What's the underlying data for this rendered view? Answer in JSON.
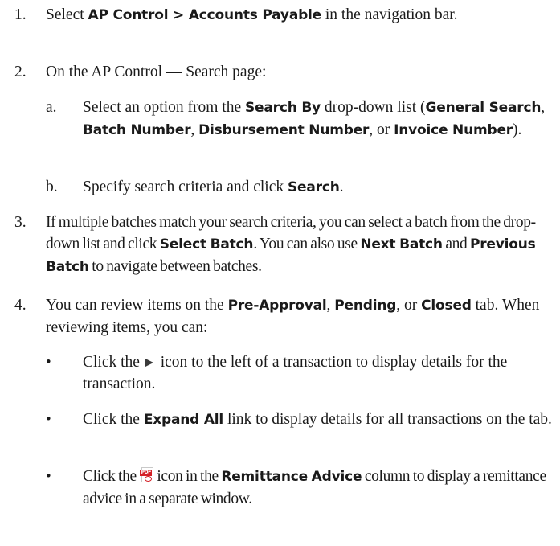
{
  "steps": [
    {
      "num": "1.",
      "parts": [
        "Select ",
        "AP Control > Accounts Payable",
        " in the navigation bar."
      ]
    },
    {
      "num": "2.",
      "text": "On the AP Control — Search page:",
      "substeps": [
        {
          "letter": "a.",
          "parts": [
            "Select an option from the ",
            "Search By",
            " drop-down list (",
            "General Search",
            ", ",
            "Batch Number",
            ", ",
            "Disbursement Number",
            ", or ",
            "Invoice Number",
            ")."
          ]
        },
        {
          "letter": "b.",
          "parts": [
            "Specify search criteria and click ",
            "Search",
            "."
          ]
        }
      ]
    },
    {
      "num": "3.",
      "parts": [
        "If multiple batches match your search criteria, you can select a batch from the drop-down list and click ",
        "Select Batch",
        ". You can also use ",
        "Next Batch",
        " and ",
        "Previous Batch",
        " to navigate between batches."
      ]
    },
    {
      "num": "4.",
      "parts": [
        "You can review items on the ",
        "Pre-Approval",
        ", ",
        "Pending",
        ", or ",
        "Closed",
        " tab. When reviewing items, you can:"
      ],
      "bullets": [
        {
          "marker": "•",
          "parts": [
            "Click the ",
            " icon to the left of a transaction to display details for the transaction."
          ],
          "icon": "expand-arrow-icon"
        },
        {
          "marker": "•",
          "parts": [
            "Click the ",
            "Expand All",
            " link to display details for all transactions on the tab."
          ]
        },
        {
          "marker": "•",
          "parts": [
            "Click the ",
            "icon in the ",
            "Remittance Advice",
            " column to display a remittance advice in a separate window."
          ],
          "icon": "pdf-icon",
          "icon_label": "PDF"
        }
      ]
    }
  ]
}
